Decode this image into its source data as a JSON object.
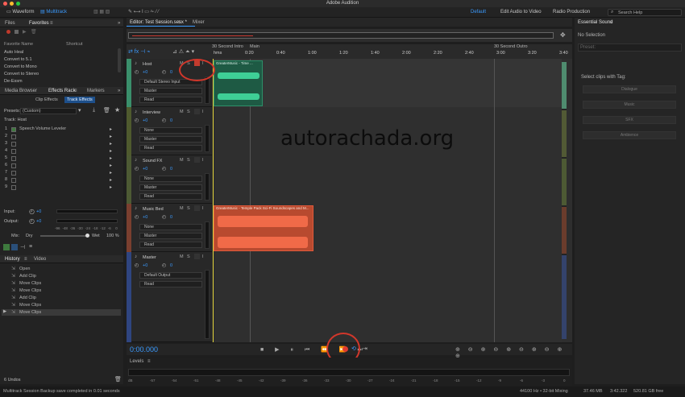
{
  "window": {
    "title": "Adobe Audition"
  },
  "toolbar": {
    "waveform": "Waveform",
    "multitrack": "Multitrack",
    "workspace": "Default",
    "edit_audio_to_video": "Edit Audio to Video",
    "radio_production": "Radio Production",
    "search_placeholder": "Search Help"
  },
  "files_panel": {
    "tab_files": "Files",
    "tab_favorites": "Favorites",
    "col_name": "Favorite Name",
    "col_shortcut": "Shortcut",
    "items": [
      "Auto Heal",
      "Convert to 5.1",
      "Convert to Mono",
      "Convert to Stereo",
      "De-Essm"
    ]
  },
  "effects_panel": {
    "tab_media": "Media Browser",
    "tab_effects": "Effects Rack",
    "tab_markers": "Markers",
    "sub_clip": "Clip Effects",
    "sub_track": "Track Effects",
    "presets_label": "Presets:",
    "presets_value": "(Custom)",
    "track_label": "Track: Host",
    "slots": [
      "Speech Volume Leveler",
      "",
      "",
      "",
      "",
      "",
      "",
      "",
      ""
    ],
    "input": "Input:",
    "output": "Output:",
    "input_val": "+0",
    "output_val": "+0",
    "mix": "Mix:",
    "dry": "Dry",
    "wet": "Wet",
    "mix_pct": "100 %",
    "meter_ticks": [
      "-96",
      "-48",
      "-36",
      "-30",
      "-24",
      "-18",
      "-12",
      "-6",
      "0"
    ]
  },
  "history_panel": {
    "tab_history": "History",
    "tab_video": "Video",
    "items": [
      "Open",
      "Add Clip",
      "Move Clips",
      "Move Clips",
      "Add Clip",
      "Move Clips",
      "Move Clips"
    ],
    "undos": "6 Undos"
  },
  "editor": {
    "tab_editor": "Editor: Test Session.sesx *",
    "tab_mixer": "Mixer",
    "markers": [
      "30 Second Intro",
      "Main",
      "30 Second Outro"
    ],
    "ticks": [
      "hms",
      "0:20",
      "0:40",
      "1:00",
      "1:20",
      "1:40",
      "2:00",
      "2:20",
      "2:40",
      "3:00",
      "3:20",
      "3:40"
    ],
    "time": "0:00.000"
  },
  "tracks": [
    {
      "name": "Host",
      "vol": "+0",
      "pan": "0",
      "input": "Default Stereo Input",
      "output": "Master",
      "mode": "Read",
      "clip": "GreaterMusic - Time ..."
    },
    {
      "name": "Interview",
      "vol": "+0",
      "pan": "0",
      "input": "None",
      "output": "Master",
      "mode": "Read"
    },
    {
      "name": "Sound FX",
      "vol": "+0",
      "pan": "0",
      "input": "None",
      "output": "Master",
      "mode": "Read"
    },
    {
      "name": "Music Bed",
      "vol": "+0",
      "pan": "0",
      "input": "None",
      "output": "Master",
      "mode": "Read",
      "clip": "GreaterMusic - Temple Pack Sci-Fi Soundscapes and M..."
    },
    {
      "name": "Master",
      "vol": "+0",
      "pan": "0",
      "output": "Default Output",
      "mode": "Read"
    }
  ],
  "levels": {
    "title": "Levels",
    "ticks": [
      "dB",
      "-57",
      "-54",
      "-51",
      "-48",
      "-45",
      "-42",
      "-39",
      "-36",
      "-33",
      "-30",
      "-27",
      "-24",
      "-21",
      "-18",
      "-15",
      "-12",
      "-9",
      "-6",
      "-3",
      "0"
    ]
  },
  "essential_sound": {
    "title": "Essential Sound",
    "status": "No Selection",
    "preset": "Preset:",
    "prompt": "Select clips with Tag:",
    "buttons": [
      "Dialogue",
      "Music",
      "SFX",
      "Ambience"
    ]
  },
  "status": {
    "message": "Multitrack Session Backup save completed in 0.01 seconds",
    "sample": "44100 Hz • 32-bit Mixing",
    "size": "37.46 MB",
    "duration": "3:42.322",
    "free": "520.81 GB free"
  },
  "watermark": "autorachada.org",
  "colors": {
    "accent": "#3b9bff",
    "record": "#e03a2e",
    "music_clip": "#e0583a",
    "host_clip": "#2fa57a"
  }
}
